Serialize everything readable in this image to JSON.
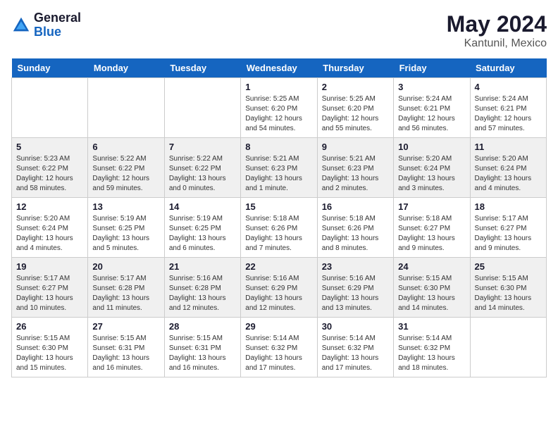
{
  "logo": {
    "line1": "General",
    "line2": "Blue"
  },
  "title": {
    "month_year": "May 2024",
    "location": "Kantunil, Mexico"
  },
  "weekdays": [
    "Sunday",
    "Monday",
    "Tuesday",
    "Wednesday",
    "Thursday",
    "Friday",
    "Saturday"
  ],
  "weeks": [
    {
      "shaded": false,
      "days": [
        {
          "num": "",
          "info": ""
        },
        {
          "num": "",
          "info": ""
        },
        {
          "num": "",
          "info": ""
        },
        {
          "num": "1",
          "info": "Sunrise: 5:25 AM\nSunset: 6:20 PM\nDaylight: 12 hours\nand 54 minutes."
        },
        {
          "num": "2",
          "info": "Sunrise: 5:25 AM\nSunset: 6:20 PM\nDaylight: 12 hours\nand 55 minutes."
        },
        {
          "num": "3",
          "info": "Sunrise: 5:24 AM\nSunset: 6:21 PM\nDaylight: 12 hours\nand 56 minutes."
        },
        {
          "num": "4",
          "info": "Sunrise: 5:24 AM\nSunset: 6:21 PM\nDaylight: 12 hours\nand 57 minutes."
        }
      ]
    },
    {
      "shaded": true,
      "days": [
        {
          "num": "5",
          "info": "Sunrise: 5:23 AM\nSunset: 6:22 PM\nDaylight: 12 hours\nand 58 minutes."
        },
        {
          "num": "6",
          "info": "Sunrise: 5:22 AM\nSunset: 6:22 PM\nDaylight: 12 hours\nand 59 minutes."
        },
        {
          "num": "7",
          "info": "Sunrise: 5:22 AM\nSunset: 6:22 PM\nDaylight: 13 hours\nand 0 minutes."
        },
        {
          "num": "8",
          "info": "Sunrise: 5:21 AM\nSunset: 6:23 PM\nDaylight: 13 hours\nand 1 minute."
        },
        {
          "num": "9",
          "info": "Sunrise: 5:21 AM\nSunset: 6:23 PM\nDaylight: 13 hours\nand 2 minutes."
        },
        {
          "num": "10",
          "info": "Sunrise: 5:20 AM\nSunset: 6:24 PM\nDaylight: 13 hours\nand 3 minutes."
        },
        {
          "num": "11",
          "info": "Sunrise: 5:20 AM\nSunset: 6:24 PM\nDaylight: 13 hours\nand 4 minutes."
        }
      ]
    },
    {
      "shaded": false,
      "days": [
        {
          "num": "12",
          "info": "Sunrise: 5:20 AM\nSunset: 6:24 PM\nDaylight: 13 hours\nand 4 minutes."
        },
        {
          "num": "13",
          "info": "Sunrise: 5:19 AM\nSunset: 6:25 PM\nDaylight: 13 hours\nand 5 minutes."
        },
        {
          "num": "14",
          "info": "Sunrise: 5:19 AM\nSunset: 6:25 PM\nDaylight: 13 hours\nand 6 minutes."
        },
        {
          "num": "15",
          "info": "Sunrise: 5:18 AM\nSunset: 6:26 PM\nDaylight: 13 hours\nand 7 minutes."
        },
        {
          "num": "16",
          "info": "Sunrise: 5:18 AM\nSunset: 6:26 PM\nDaylight: 13 hours\nand 8 minutes."
        },
        {
          "num": "17",
          "info": "Sunrise: 5:18 AM\nSunset: 6:27 PM\nDaylight: 13 hours\nand 9 minutes."
        },
        {
          "num": "18",
          "info": "Sunrise: 5:17 AM\nSunset: 6:27 PM\nDaylight: 13 hours\nand 9 minutes."
        }
      ]
    },
    {
      "shaded": true,
      "days": [
        {
          "num": "19",
          "info": "Sunrise: 5:17 AM\nSunset: 6:27 PM\nDaylight: 13 hours\nand 10 minutes."
        },
        {
          "num": "20",
          "info": "Sunrise: 5:17 AM\nSunset: 6:28 PM\nDaylight: 13 hours\nand 11 minutes."
        },
        {
          "num": "21",
          "info": "Sunrise: 5:16 AM\nSunset: 6:28 PM\nDaylight: 13 hours\nand 12 minutes."
        },
        {
          "num": "22",
          "info": "Sunrise: 5:16 AM\nSunset: 6:29 PM\nDaylight: 13 hours\nand 12 minutes."
        },
        {
          "num": "23",
          "info": "Sunrise: 5:16 AM\nSunset: 6:29 PM\nDaylight: 13 hours\nand 13 minutes."
        },
        {
          "num": "24",
          "info": "Sunrise: 5:15 AM\nSunset: 6:30 PM\nDaylight: 13 hours\nand 14 minutes."
        },
        {
          "num": "25",
          "info": "Sunrise: 5:15 AM\nSunset: 6:30 PM\nDaylight: 13 hours\nand 14 minutes."
        }
      ]
    },
    {
      "shaded": false,
      "days": [
        {
          "num": "26",
          "info": "Sunrise: 5:15 AM\nSunset: 6:30 PM\nDaylight: 13 hours\nand 15 minutes."
        },
        {
          "num": "27",
          "info": "Sunrise: 5:15 AM\nSunset: 6:31 PM\nDaylight: 13 hours\nand 16 minutes."
        },
        {
          "num": "28",
          "info": "Sunrise: 5:15 AM\nSunset: 6:31 PM\nDaylight: 13 hours\nand 16 minutes."
        },
        {
          "num": "29",
          "info": "Sunrise: 5:14 AM\nSunset: 6:32 PM\nDaylight: 13 hours\nand 17 minutes."
        },
        {
          "num": "30",
          "info": "Sunrise: 5:14 AM\nSunset: 6:32 PM\nDaylight: 13 hours\nand 17 minutes."
        },
        {
          "num": "31",
          "info": "Sunrise: 5:14 AM\nSunset: 6:32 PM\nDaylight: 13 hours\nand 18 minutes."
        },
        {
          "num": "",
          "info": ""
        }
      ]
    }
  ]
}
